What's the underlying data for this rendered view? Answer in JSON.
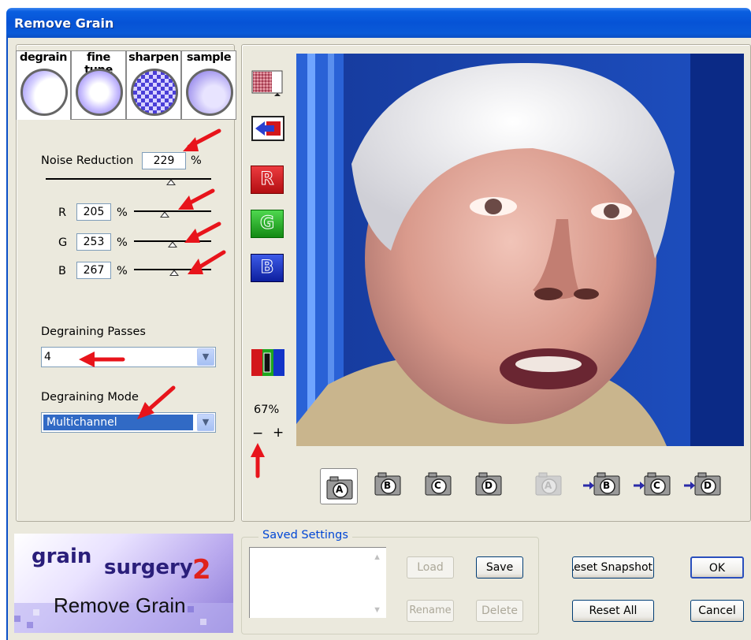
{
  "window": {
    "title": "Remove Grain"
  },
  "tabs": [
    {
      "label": "degrain",
      "icon": "degrain-tab-icon"
    },
    {
      "label": "fine tune",
      "icon": "fine-tune-tab-icon"
    },
    {
      "label": "sharpen",
      "icon": "sharpen-tab-icon"
    },
    {
      "label": "sample",
      "icon": "sample-tab-icon"
    }
  ],
  "noise": {
    "label": "Noise Reduction",
    "value": "229",
    "unit": "%",
    "channels": [
      {
        "label": "R",
        "value": "205",
        "unit": "%"
      },
      {
        "label": "G",
        "value": "253",
        "unit": "%"
      },
      {
        "label": "B",
        "value": "267",
        "unit": "%"
      }
    ]
  },
  "passes": {
    "label": "Degraining Passes",
    "value": "4"
  },
  "mode": {
    "label": "Degraining Mode",
    "value": "Multichannel"
  },
  "tools": {
    "r": "R",
    "g": "G",
    "b": "B",
    "zoom": "67%",
    "zoom_out": "−",
    "zoom_in": "+"
  },
  "snapshots": [
    "A",
    "B",
    "C",
    "D",
    "A",
    "B",
    "C",
    "D"
  ],
  "saved": {
    "legend": "Saved Settings",
    "load": "Load",
    "save": "Save",
    "rename": "Rename",
    "delete": "Delete"
  },
  "buttons": {
    "reset_snapshot": "Reset Snapshot",
    "reset_all": "Reset All",
    "ok": "OK",
    "cancel": "Cancel"
  },
  "logo": {
    "brand": "grain",
    "brand2": "surgery",
    "version": "2",
    "product": "Remove Grain"
  },
  "colors": {
    "title_bar": "#0653d6",
    "arrow": "#e8141b",
    "selection": "#316ac5",
    "r": "#d3171b",
    "g": "#1ea51e",
    "b": "#1234c8"
  }
}
